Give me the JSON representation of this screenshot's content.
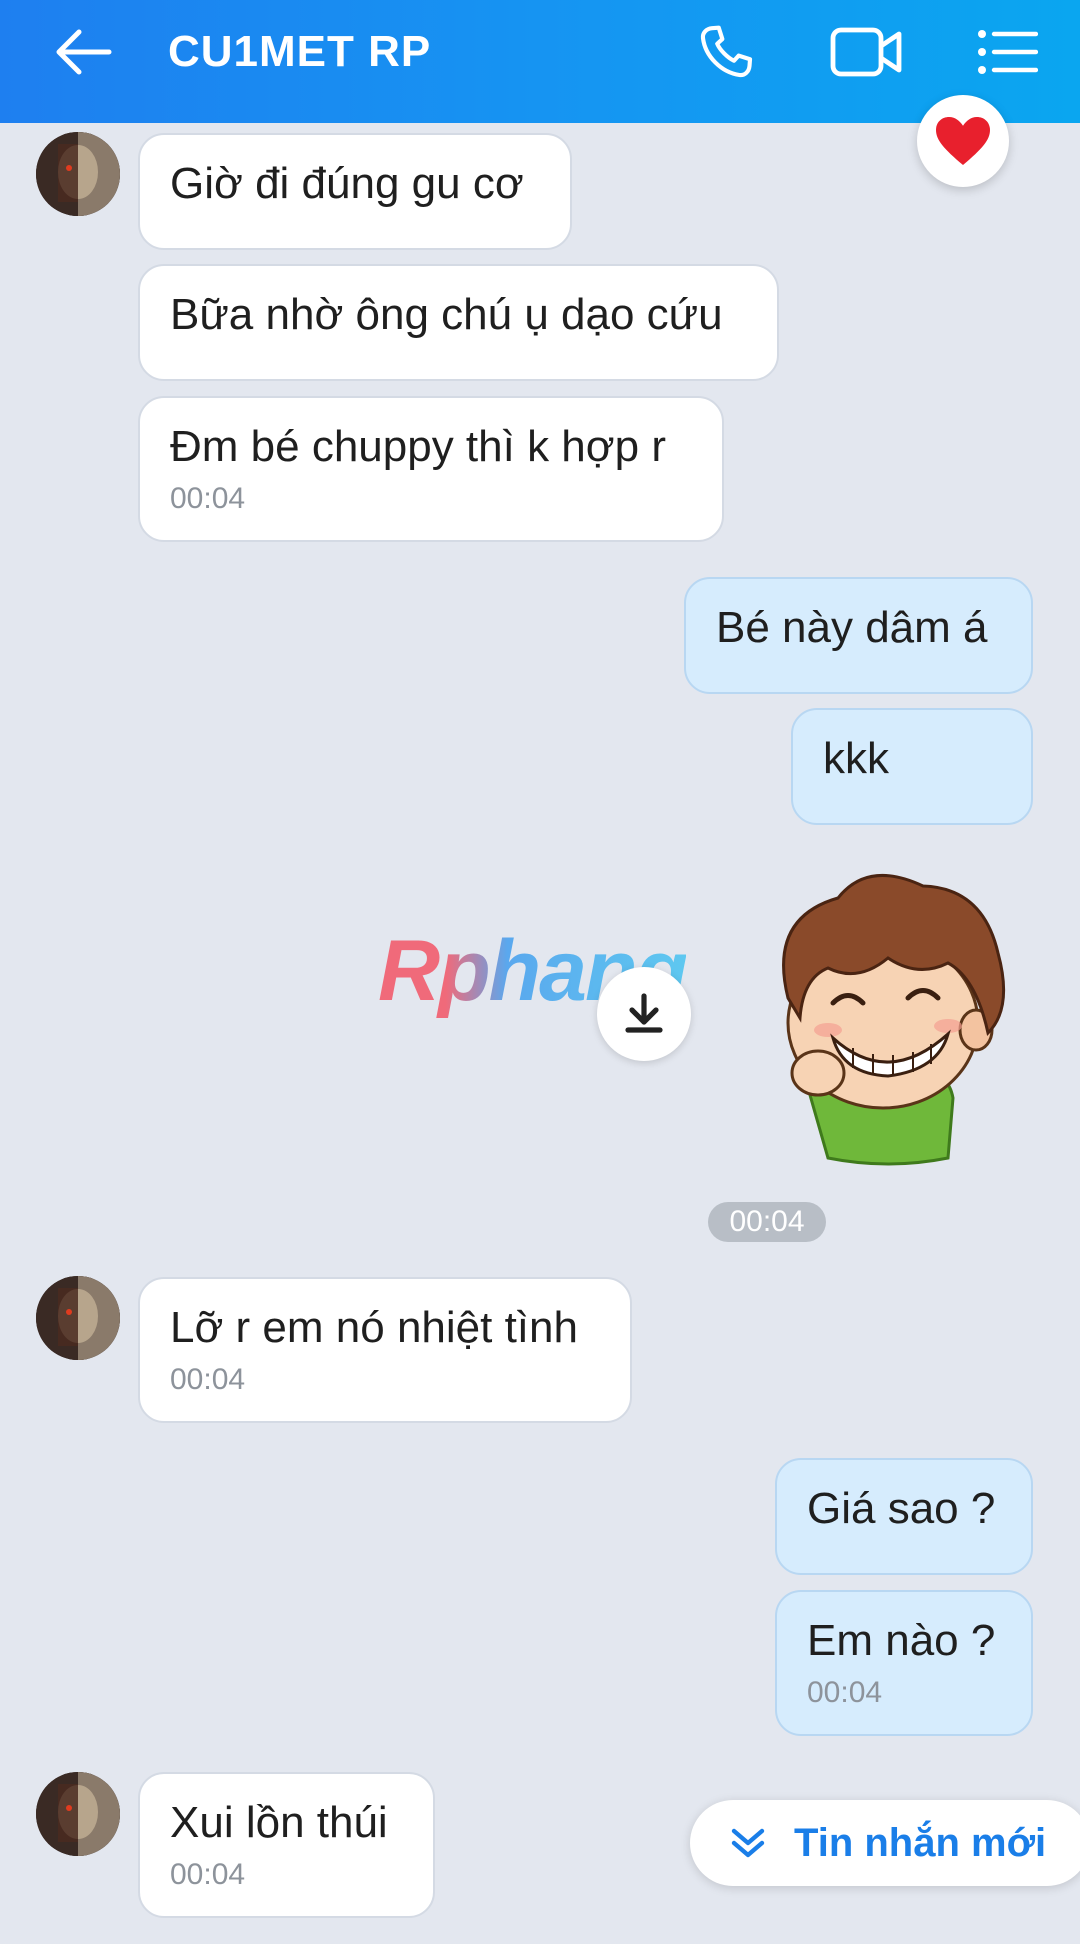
{
  "header": {
    "title": "CU1MET RP",
    "back_icon": "arrow-left-icon",
    "call_icon": "phone-icon",
    "video_icon": "video-camera-icon",
    "menu_icon": "list-menu-icon"
  },
  "colors": {
    "header_start": "#1e7ff0",
    "header_end": "#0aa6f0",
    "background": "#e3e7ef",
    "outgoing_bubble": "#d6ecfd",
    "incoming_bubble": "#ffffff",
    "accent": "#1a7ee8"
  },
  "messages": [
    {
      "side": "in",
      "text": "Giờ đi đúng gu cơ",
      "time": ""
    },
    {
      "side": "in",
      "text": "Bữa nhờ ông chú ụ dạo cứu",
      "time": ""
    },
    {
      "side": "in",
      "text": "Đm bé chuppy thì k hợp r",
      "time": "00:04"
    },
    {
      "side": "out",
      "text": "Bé này dâm á",
      "time": ""
    },
    {
      "side": "out",
      "text": "kkk",
      "time": ""
    },
    {
      "side": "in",
      "text": "Lỡ r em nó nhiệt tình",
      "time": "00:04"
    },
    {
      "side": "out",
      "text": "Giá sao ?",
      "time": ""
    },
    {
      "side": "out",
      "text": "Em nào ?",
      "time": "00:04"
    },
    {
      "side": "in",
      "text": "Xui lồn thúi",
      "time": "00:04"
    }
  ],
  "sticker": {
    "time": "00:04",
    "icon": "download-icon"
  },
  "watermark": "Rphang",
  "new_messages_button": {
    "label": "Tin nhắn mới",
    "icon": "chevron-double-down-icon"
  },
  "quick_reaction_icon": "heart-icon"
}
